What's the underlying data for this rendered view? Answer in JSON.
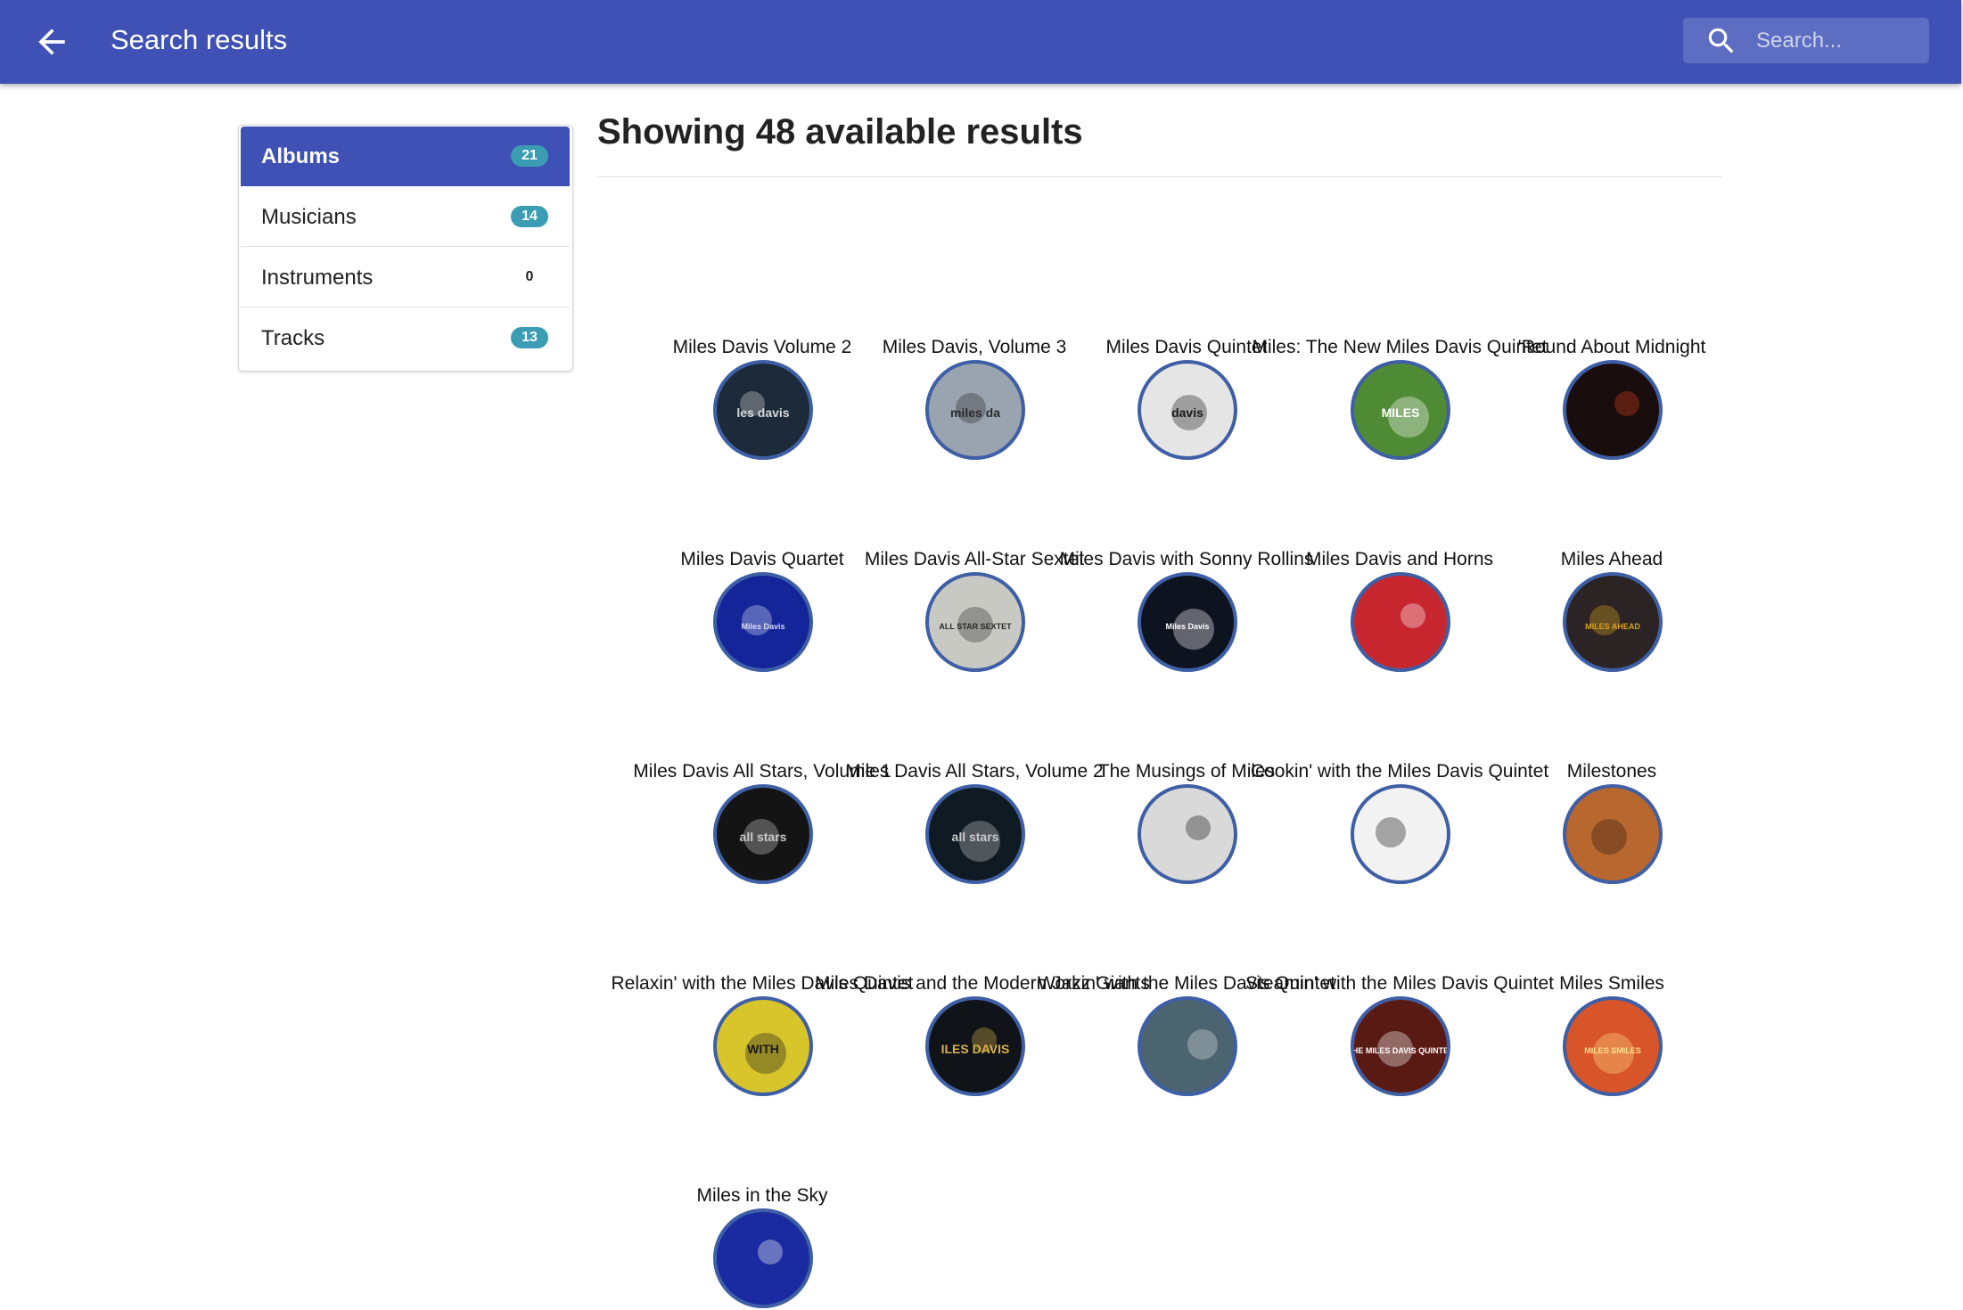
{
  "header": {
    "title": "Search results",
    "search_placeholder": "Search..."
  },
  "categories": [
    {
      "label": "Albums",
      "count": "21",
      "active": true
    },
    {
      "label": "Musicians",
      "count": "14",
      "active": false
    },
    {
      "label": "Instruments",
      "count": "0",
      "active": false
    },
    {
      "label": "Tracks",
      "count": "13",
      "active": false
    }
  ],
  "results": {
    "heading": "Showing 48 available results",
    "albums": [
      {
        "title": "Miles Davis Volume 2",
        "bg": "#1c2a3a",
        "fg": "#d9d9d9",
        "cover_text": "les davis"
      },
      {
        "title": "Miles Davis, Volume 3",
        "bg": "#9aa4b0",
        "fg": "#2b2b2b",
        "cover_text": "miles da"
      },
      {
        "title": "Miles Davis Quintet",
        "bg": "#e5e5e5",
        "fg": "#1a1a1a",
        "cover_text": "davis"
      },
      {
        "title": "Miles: The New Miles Davis Quintet",
        "bg": "#4f8a35",
        "fg": "#ffffff",
        "cover_text": "MILES"
      },
      {
        "title": "'Round About Midnight",
        "bg": "#1a0d0d",
        "fg": "#d8421e",
        "cover_text": ""
      },
      {
        "title": "Miles Davis Quartet",
        "bg": "#14259a",
        "fg": "#d8dcf0",
        "cover_text": "Miles Davis"
      },
      {
        "title": "Miles Davis All-Star Sextet",
        "bg": "#c9c9c4",
        "fg": "#2a2a2a",
        "cover_text": "ALL STAR SEXTET"
      },
      {
        "title": "Miles Davis with Sonny Rollins",
        "bg": "#0e1320",
        "fg": "#ffffff",
        "cover_text": "Miles Davis"
      },
      {
        "title": "Miles Davis and Horns",
        "bg": "#c8262e",
        "fg": "#ffffff",
        "cover_text": ""
      },
      {
        "title": "Miles Ahead",
        "bg": "#2c2424",
        "fg": "#d6a21e",
        "cover_text": "MILES AHEAD"
      },
      {
        "title": "Miles Davis All Stars, Volume 1",
        "bg": "#141414",
        "fg": "#c9c9c9",
        "cover_text": "all stars"
      },
      {
        "title": "Miles Davis All Stars, Volume 2",
        "bg": "#0f1a22",
        "fg": "#c9c9c9",
        "cover_text": "all stars"
      },
      {
        "title": "The Musings of Miles",
        "bg": "#d9d9d9",
        "fg": "#111111",
        "cover_text": ""
      },
      {
        "title": "Cookin' with the Miles Davis Quintet",
        "bg": "#f2f2f2",
        "fg": "#111111",
        "cover_text": ""
      },
      {
        "title": "Milestones",
        "bg": "#b8672e",
        "fg": "#2a1a10",
        "cover_text": ""
      },
      {
        "title": "Relaxin' with the Miles Davis Quintet",
        "bg": "#d8c52c",
        "fg": "#1a1a1a",
        "cover_text": "WITH"
      },
      {
        "title": "Miles Davis and the Modern Jazz Giants",
        "bg": "#101418",
        "fg": "#d9b24a",
        "cover_text": "ILES DAVIS"
      },
      {
        "title": "Workin' with the Miles Davis Quintet",
        "bg": "#4b6470",
        "fg": "#e0e0e0",
        "cover_text": ""
      },
      {
        "title": "Steamin' with the Miles Davis Quintet",
        "bg": "#5a1a14",
        "fg": "#ffffff",
        "cover_text": "THE MILES DAVIS QUINTET"
      },
      {
        "title": "Miles Smiles",
        "bg": "#d8552a",
        "fg": "#ffe08a",
        "cover_text": "MILES SMILES"
      },
      {
        "title": "Miles in the Sky",
        "bg": "#1a2aa0",
        "fg": "#ffffff",
        "cover_text": ""
      }
    ]
  },
  "colors": {
    "appbar": "#3f51b5",
    "badge": "#3a9db3",
    "cover_border": "#3e5fa5"
  },
  "icons": {
    "back": "arrow-back-icon",
    "search": "search-icon"
  }
}
